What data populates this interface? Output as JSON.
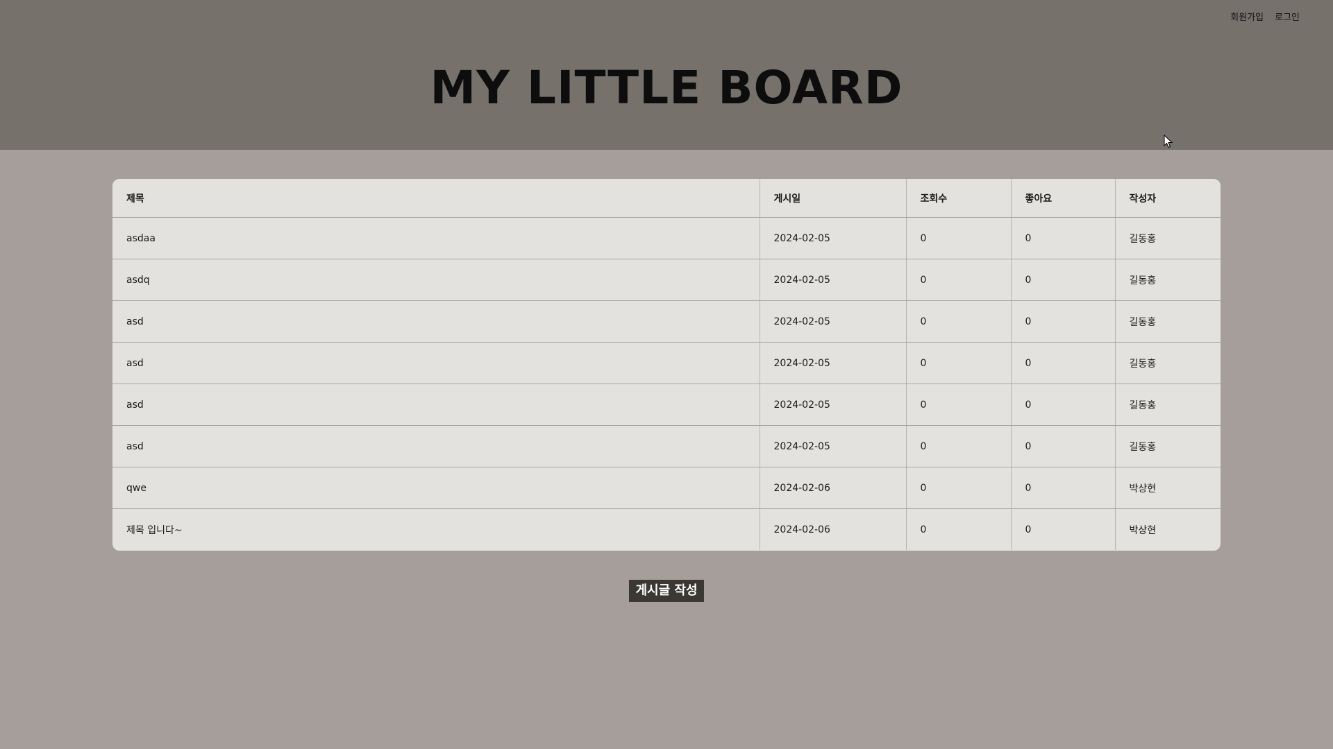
{
  "nav": {
    "signup_label": "회원가입",
    "login_label": "로그인"
  },
  "header": {
    "title": "MY LITTLE BOARD"
  },
  "table": {
    "columns": [
      "제목",
      "게시일",
      "조회수",
      "좋아요",
      "작성자"
    ],
    "rows": [
      {
        "title": "asdaa",
        "date": "2024-02-05",
        "views": "0",
        "likes": "0",
        "author": "길동홍"
      },
      {
        "title": "asdq",
        "date": "2024-02-05",
        "views": "0",
        "likes": "0",
        "author": "길동홍"
      },
      {
        "title": "asd",
        "date": "2024-02-05",
        "views": "0",
        "likes": "0",
        "author": "길동홍"
      },
      {
        "title": "asd",
        "date": "2024-02-05",
        "views": "0",
        "likes": "0",
        "author": "길동홍"
      },
      {
        "title": "asd",
        "date": "2024-02-05",
        "views": "0",
        "likes": "0",
        "author": "길동홍"
      },
      {
        "title": "asd",
        "date": "2024-02-05",
        "views": "0",
        "likes": "0",
        "author": "길동홍"
      },
      {
        "title": "qwe",
        "date": "2024-02-06",
        "views": "0",
        "likes": "0",
        "author": "박상현"
      },
      {
        "title": "제목 입니다~",
        "date": "2024-02-06",
        "views": "0",
        "likes": "0",
        "author": "박상현"
      }
    ]
  },
  "actions": {
    "write_label": "게시글 작성"
  },
  "colors": {
    "header_bg": "#77716c",
    "page_bg": "#a59e9a",
    "table_bg": "#e4e2df",
    "button_bg": "#3b3733"
  }
}
